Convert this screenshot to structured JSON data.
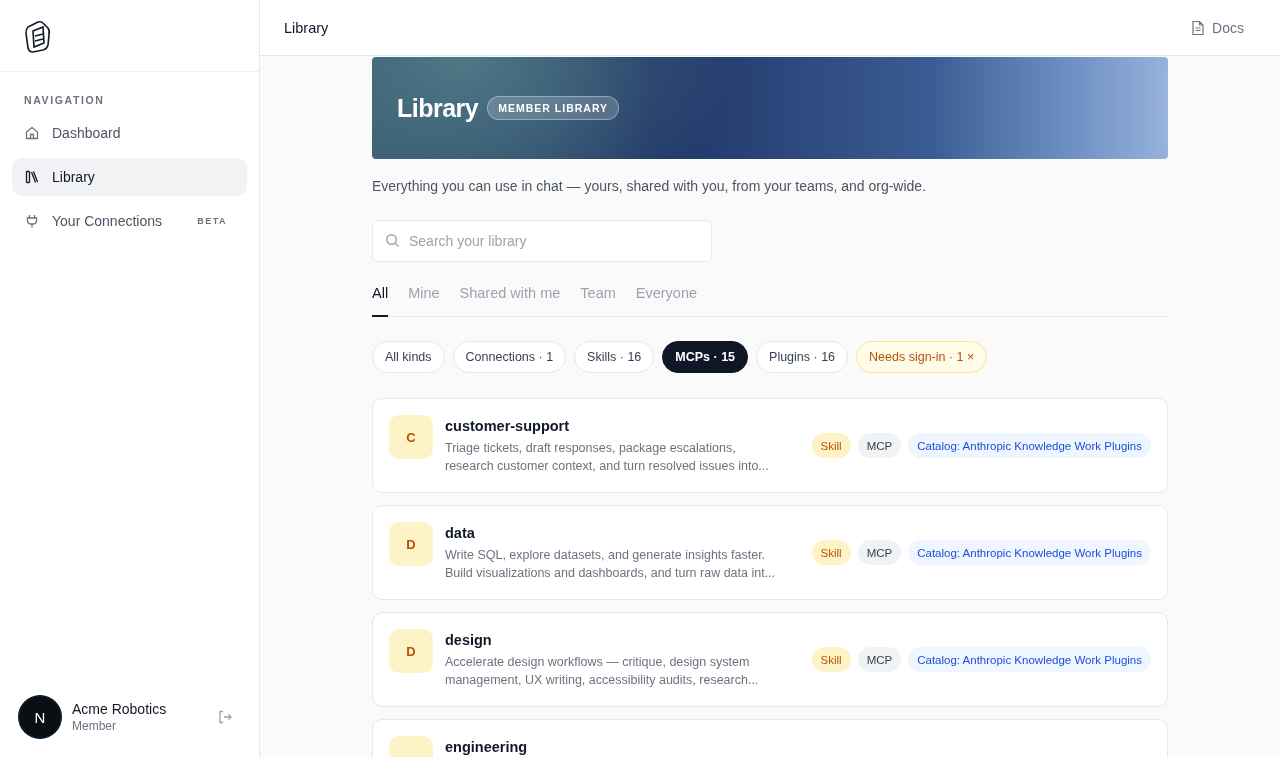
{
  "sidebar": {
    "section_label": "NAVIGATION",
    "items": [
      {
        "label": "Dashboard",
        "selected": false
      },
      {
        "label": "Library",
        "selected": true
      },
      {
        "label": "Your Connections",
        "selected": false,
        "badge": "BETA"
      }
    ],
    "account": {
      "initial": "N",
      "name": "Acme Robotics",
      "role": "Member"
    }
  },
  "header": {
    "title": "Library",
    "docs": "Docs"
  },
  "hero": {
    "title": "Library",
    "badge": "MEMBER LIBRARY"
  },
  "subtitle": "Everything you can use in chat — yours, shared with you, from your teams, and org-wide.",
  "search": {
    "placeholder": "Search your library"
  },
  "tabs": [
    {
      "label": "All",
      "selected": true
    },
    {
      "label": "Mine",
      "selected": false
    },
    {
      "label": "Shared with me",
      "selected": false
    },
    {
      "label": "Team",
      "selected": false
    },
    {
      "label": "Everyone",
      "selected": false
    }
  ],
  "filters": [
    {
      "label": "All kinds",
      "kind": "plain",
      "selected": false
    },
    {
      "label": "Connections · 1",
      "kind": "plain",
      "selected": false
    },
    {
      "label": "Skills · 16",
      "kind": "plain",
      "selected": false
    },
    {
      "label": "MCPs · 15",
      "kind": "plain",
      "selected": true
    },
    {
      "label": "Plugins · 16",
      "kind": "plain",
      "selected": false
    },
    {
      "label": "Needs sign-in · 1 ×",
      "kind": "warning",
      "selected": false
    }
  ],
  "items": [
    {
      "initial": "C",
      "name": "customer-support",
      "description": "Triage tickets, draft responses, package escalations, research customer context, and turn resolved issues into...",
      "tags": [
        {
          "label": "Skill",
          "kind": "skill"
        },
        {
          "label": "MCP",
          "kind": "mcp"
        },
        {
          "label": "Catalog: Anthropic Knowledge Work Plugins",
          "kind": "catalog"
        }
      ]
    },
    {
      "initial": "D",
      "name": "data",
      "description": "Write SQL, explore datasets, and generate insights faster. Build visualizations and dashboards, and turn raw data int...",
      "tags": [
        {
          "label": "Skill",
          "kind": "skill"
        },
        {
          "label": "MCP",
          "kind": "mcp"
        },
        {
          "label": "Catalog: Anthropic Knowledge Work Plugins",
          "kind": "catalog"
        }
      ]
    },
    {
      "initial": "D",
      "name": "design",
      "description": "Accelerate design workflows — critique, design system management, UX writing, accessibility audits, research...",
      "tags": [
        {
          "label": "Skill",
          "kind": "skill"
        },
        {
          "label": "MCP",
          "kind": "mcp"
        },
        {
          "label": "Catalog: Anthropic Knowledge Work Plugins",
          "kind": "catalog"
        }
      ]
    },
    {
      "name": "engineering"
    }
  ]
}
